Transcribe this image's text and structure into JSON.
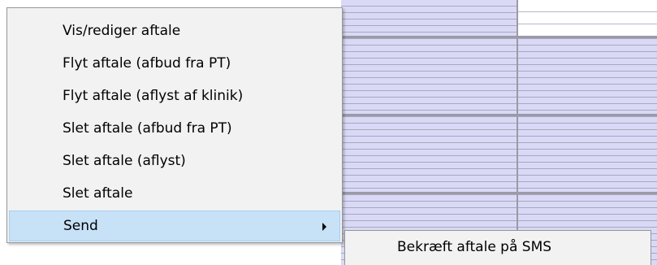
{
  "context_menu": {
    "items": [
      {
        "label": "Vis/rediger aftale"
      },
      {
        "label": "Flyt aftale (afbud fra PT)"
      },
      {
        "label": "Flyt aftale (aflyst af klinik)"
      },
      {
        "label": "Slet aftale (afbud fra PT)"
      },
      {
        "label": "Slet aftale (aflyst)"
      },
      {
        "label": "Slet aftale"
      },
      {
        "label": "Send",
        "highlighted": true,
        "has_submenu": true
      }
    ]
  },
  "submenu": {
    "items": [
      {
        "label": "Bekræft aftale på SMS"
      }
    ]
  },
  "colors": {
    "calendar_slot": "#d9d9f7",
    "menu_background": "#f2f2f2",
    "highlight": "#c7e1f7"
  }
}
